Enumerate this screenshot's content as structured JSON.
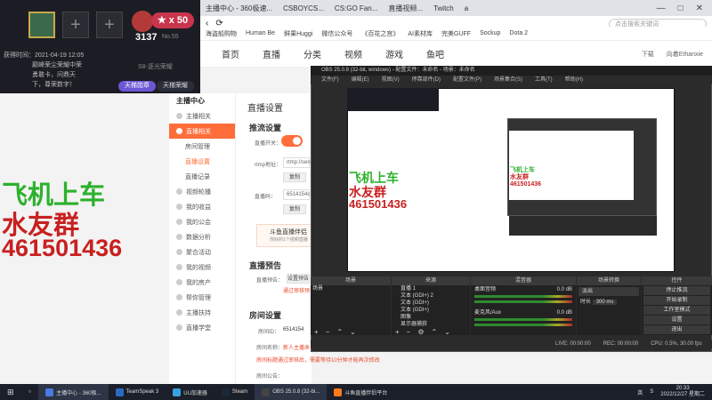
{
  "browser": {
    "tabs": [
      "主播中心 - 360极速...",
      "CSBOYCS...",
      "CS:GO Fan...",
      "直播视频...",
      "Twitch",
      "a"
    ],
    "search_placeholder": "点击搜索关键词",
    "bookmarks": [
      "海盗船购物",
      "Human Be",
      "鲜果Huggi",
      "微信公众号",
      "《百花之宫》",
      "AI素材库",
      "完美GUFF",
      "Sockup",
      "Dota 2"
    ],
    "window_controls": [
      "—",
      "□",
      "✕"
    ]
  },
  "site_header": {
    "nav": [
      "首页",
      "直播",
      "分类",
      "视频",
      "游戏",
      "鱼吧"
    ],
    "right": [
      "下载",
      "向着Ethanxie"
    ]
  },
  "overlay": {
    "star": "★ x 50",
    "num": "3137",
    "no": "No.55",
    "date": "获得时间：2021-04-19 12:05",
    "msg_lines": [
      "巅峰荣尘荣耀中荣",
      "勇敢卡，问鼎天",
      "下，尊荣数字！"
    ],
    "s8": "S8-逐光荣耀",
    "btn1": "天梯勋章",
    "btn2": "天梯荣耀"
  },
  "qq": {
    "line1": "飞机上车",
    "line2": "水友群",
    "line3": "461501436"
  },
  "sidebar": {
    "head": "主播中心",
    "items": [
      {
        "label": "主播相关",
        "kind": "group"
      },
      {
        "label": "直播相关",
        "kind": "active"
      },
      {
        "label": "房间管理",
        "kind": "sub"
      },
      {
        "label": "直播设置",
        "kind": "sub-on"
      },
      {
        "label": "直播记录",
        "kind": "sub"
      },
      {
        "label": "视频轮播",
        "kind": "group"
      },
      {
        "label": "我的收益",
        "kind": "group"
      },
      {
        "label": "我的公会",
        "kind": "group"
      },
      {
        "label": "数据分析",
        "kind": "group"
      },
      {
        "label": "聚合活动",
        "kind": "group"
      },
      {
        "label": "我的视频",
        "kind": "group"
      },
      {
        "label": "我的房产",
        "kind": "group"
      },
      {
        "label": "帮你管理",
        "kind": "group"
      },
      {
        "label": "主播扶持",
        "kind": "group"
      },
      {
        "label": "直播学堂",
        "kind": "group"
      }
    ]
  },
  "main": {
    "title": "直播设置",
    "push_title": "推流设置",
    "live_switch": "直播开关：",
    "rtmp_label": "rtmp地址：",
    "rtmp_val": "rtmp://sen",
    "copy": "复制",
    "code_label": "直播码：",
    "code_val": "6514154c",
    "banner": "斗鱼直播伴侣",
    "banner_sub": "你好的1个视频直播",
    "preview_title": "直播预告",
    "preview_label": "直播预告：",
    "preview_btn": "设置预告",
    "preview_link": "通过审核预",
    "room_title": "房间设置",
    "room_id_label": "房间ID：",
    "room_id": "6514154",
    "room_name_label": "房间名称：",
    "room_name": "新人主播来",
    "notice": "房间标题通过审核后，需要等待10分钟才能再次修改",
    "notice_label": "房间公告："
  },
  "obs": {
    "title": "OBS 25.0.8 (32-bit, windows) - 配置文件：未命名 - 场景：未命名",
    "menu": [
      "文件(F)",
      "编辑(E)",
      "视图(V)",
      "停靠部件(D)",
      "配置文件(P)",
      "场景集合(S)",
      "工具(T)",
      "帮助(H)"
    ],
    "docks": [
      "场景",
      "来源",
      "混音器",
      "场景转换",
      "控件"
    ],
    "scenes": [
      "场景"
    ],
    "sources": [
      "直播 1",
      "文本 (GDI+) 2",
      "文本 (GDI+)",
      "文本 (GDI+)",
      "图像",
      "显示器捕获"
    ],
    "mixer": [
      {
        "name": "桌面音频",
        "db": "0.0 dB"
      },
      {
        "name": "麦克风/Aux",
        "db": "0.0 dB"
      }
    ],
    "transition": {
      "fade": "淡出",
      "duration_label": "时长",
      "duration": "300 ms"
    },
    "controls": [
      "停止推流",
      "开始录制",
      "工作室模式",
      "设置",
      "退出"
    ],
    "status": [
      "LIVE: 00:00:00",
      "REC: 00:00:00",
      "CPU: 0.5%, 30.00 fps"
    ]
  },
  "taskbar": {
    "items": [
      "主播中心 - 360极...",
      "TeamSpeak 3",
      "UU加速器",
      "Steam",
      "OBS 25.0.8 (32-bi...",
      "斗鱼直播伴侣平台"
    ],
    "tray": [
      "英",
      "S"
    ],
    "time": "20:33",
    "date": "2022/12/27 星期二"
  }
}
